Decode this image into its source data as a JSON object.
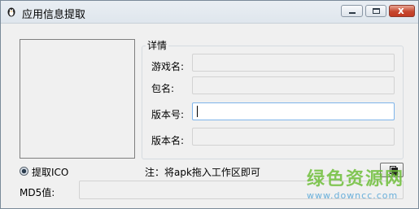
{
  "window": {
    "title": "应用信息提取",
    "app_icon": "penguin-icon",
    "controls": {
      "minimize": "minimize-icon",
      "maximize": "maximize-icon",
      "close": "close-icon",
      "close_glyph": "x"
    }
  },
  "details": {
    "group_title": "详情",
    "fields": [
      {
        "label": "游戏名:",
        "value": ""
      },
      {
        "label": "包名:",
        "value": ""
      },
      {
        "label": "版本号:",
        "value": ""
      },
      {
        "label": "版本名:",
        "value": ""
      }
    ]
  },
  "extract_ico_label": "提取ICO",
  "note": "注：将apk拖入工作区即可",
  "copy_button_icon": "copy-icon",
  "md5": {
    "label": "MD5值:",
    "value": ""
  },
  "watermark": {
    "text": "绿色资源网",
    "url": "www.downcc.com"
  },
  "colors": {
    "window_bg": "#f0f0f0",
    "focus_border": "#7eb4ea",
    "close_button": "#c6472f",
    "watermark_green": "#6fbf3a",
    "watermark_blue": "#5aa8d8"
  }
}
